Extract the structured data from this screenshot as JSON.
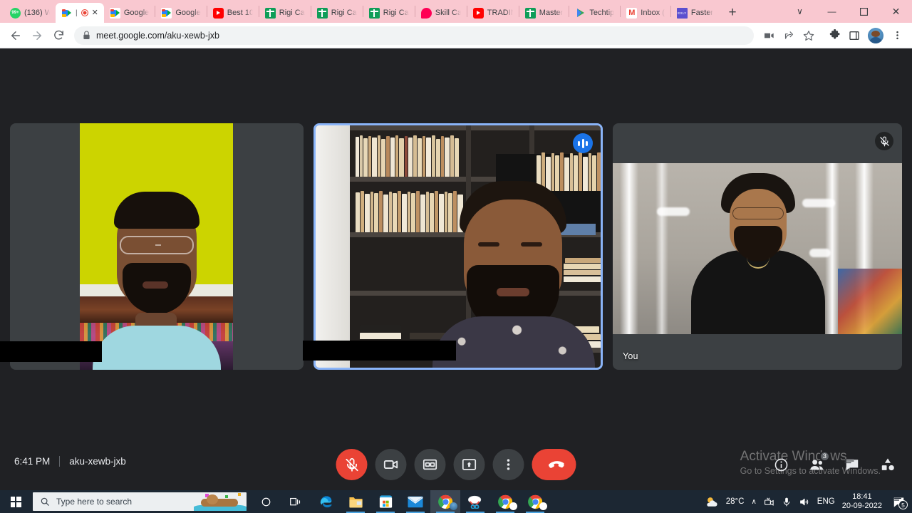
{
  "browser": {
    "tabs": [
      {
        "title": "(136) W",
        "favicon": "whatsapp-icon",
        "active": false
      },
      {
        "title": "",
        "favicon": "google-meet-icon",
        "active": true,
        "recording": true
      },
      {
        "title": "Google",
        "favicon": "google-meet-icon",
        "active": false
      },
      {
        "title": "Google",
        "favicon": "google-meet-icon",
        "active": false
      },
      {
        "title": "Best 10",
        "favicon": "youtube-icon",
        "active": false
      },
      {
        "title": "Rigi Ca",
        "favicon": "rigi-icon",
        "active": false
      },
      {
        "title": "Rigi Ca",
        "favicon": "rigi-icon",
        "active": false
      },
      {
        "title": "Rigi Ca",
        "favicon": "rigi-icon",
        "active": false
      },
      {
        "title": "Skill Ca",
        "favicon": "skillshare-icon",
        "active": false
      },
      {
        "title": "TRADIN",
        "favicon": "youtube-icon",
        "active": false
      },
      {
        "title": "Master",
        "favicon": "rigi-icon",
        "active": false
      },
      {
        "title": "Techtip",
        "favicon": "play-store-icon",
        "active": false
      },
      {
        "title": "Inbox (",
        "favicon": "gmail-icon",
        "active": false
      },
      {
        "title": "Faster ",
        "favicon": "exly-icon",
        "active": false
      }
    ],
    "new_tab_label": "+",
    "window_controls": {
      "list": "∨",
      "minimize": "—",
      "maximize": "❐",
      "close": "✕"
    },
    "nav": {
      "back": "←",
      "forward": "→",
      "reload": "⟳"
    },
    "omnibox": {
      "url": "meet.google.com/aku-xewb-jxb",
      "lock_icon": "lock-icon"
    },
    "omnibox_actions": [
      "media-cast-icon",
      "share-icon",
      "bookmark-star-icon"
    ],
    "toolbar_actions": [
      "extensions-puzzle-icon",
      "side-panel-icon",
      "profile-avatar",
      "chrome-menu-icon"
    ]
  },
  "meet": {
    "tiles": [
      {
        "id": "tile-1",
        "name": "",
        "redacted_name": true,
        "speaking": false,
        "muted": false
      },
      {
        "id": "tile-2",
        "name": "",
        "redacted_name": true,
        "speaking": true,
        "muted": false,
        "active_speaker": true
      },
      {
        "id": "tile-3",
        "name": "You",
        "redacted_name": false,
        "speaking": false,
        "muted": true
      }
    ],
    "footer": {
      "time": "6:41 PM",
      "meeting_code": "aku-xewb-jxb",
      "controls": [
        {
          "name": "microphone-muted-button",
          "icon": "mic-off-icon",
          "state": "muted",
          "color": "#ea4335"
        },
        {
          "name": "camera-button",
          "icon": "video-camera-icon",
          "state": "on",
          "color": "#3c4043"
        },
        {
          "name": "captions-button",
          "icon": "closed-captions-icon",
          "state": "off",
          "color": "#3c4043"
        },
        {
          "name": "present-now-button",
          "icon": "present-screen-icon",
          "state": "off",
          "color": "#3c4043"
        },
        {
          "name": "more-options-button",
          "icon": "more-vertical-icon",
          "state": "off",
          "color": "#3c4043"
        },
        {
          "name": "leave-call-button",
          "icon": "end-call-icon",
          "state": "leave",
          "color": "#ea4335"
        }
      ],
      "right_controls": [
        {
          "name": "meeting-details-button",
          "icon": "info-icon",
          "badge": ""
        },
        {
          "name": "show-everyone-button",
          "icon": "people-icon",
          "badge": "3"
        },
        {
          "name": "chat-button",
          "icon": "chat-bubble-icon",
          "badge": ""
        },
        {
          "name": "activities-button",
          "icon": "activities-icon",
          "badge": ""
        }
      ]
    },
    "watermark": {
      "line1": "Activate Windows",
      "line2": "Go to Settings to activate Windows."
    }
  },
  "taskbar": {
    "start_label": "start-button",
    "search_placeholder": "Type here to search",
    "icons": [
      {
        "name": "cortana-icon",
        "running": false
      },
      {
        "name": "task-view-icon",
        "running": false
      },
      {
        "name": "microsoft-edge-icon",
        "running": true
      },
      {
        "name": "file-explorer-icon",
        "running": true
      },
      {
        "name": "microsoft-store-icon",
        "running": true
      },
      {
        "name": "mail-icon",
        "running": true
      },
      {
        "name": "google-chrome-icon",
        "running": true,
        "active": true
      },
      {
        "name": "snipping-tool-icon",
        "running": true
      },
      {
        "name": "google-chrome-icon",
        "running": true
      },
      {
        "name": "google-chrome-icon",
        "running": true
      }
    ],
    "tray": {
      "weather_icon": "partly-cloudy-icon",
      "temperature": "28°C",
      "chevron": "∧",
      "icons": [
        "camera-tray-icon",
        "microphone-tray-icon",
        "volume-icon"
      ],
      "language": "ENG",
      "time": "18:41",
      "date": "20-09-2022",
      "notification_count": "5"
    }
  }
}
